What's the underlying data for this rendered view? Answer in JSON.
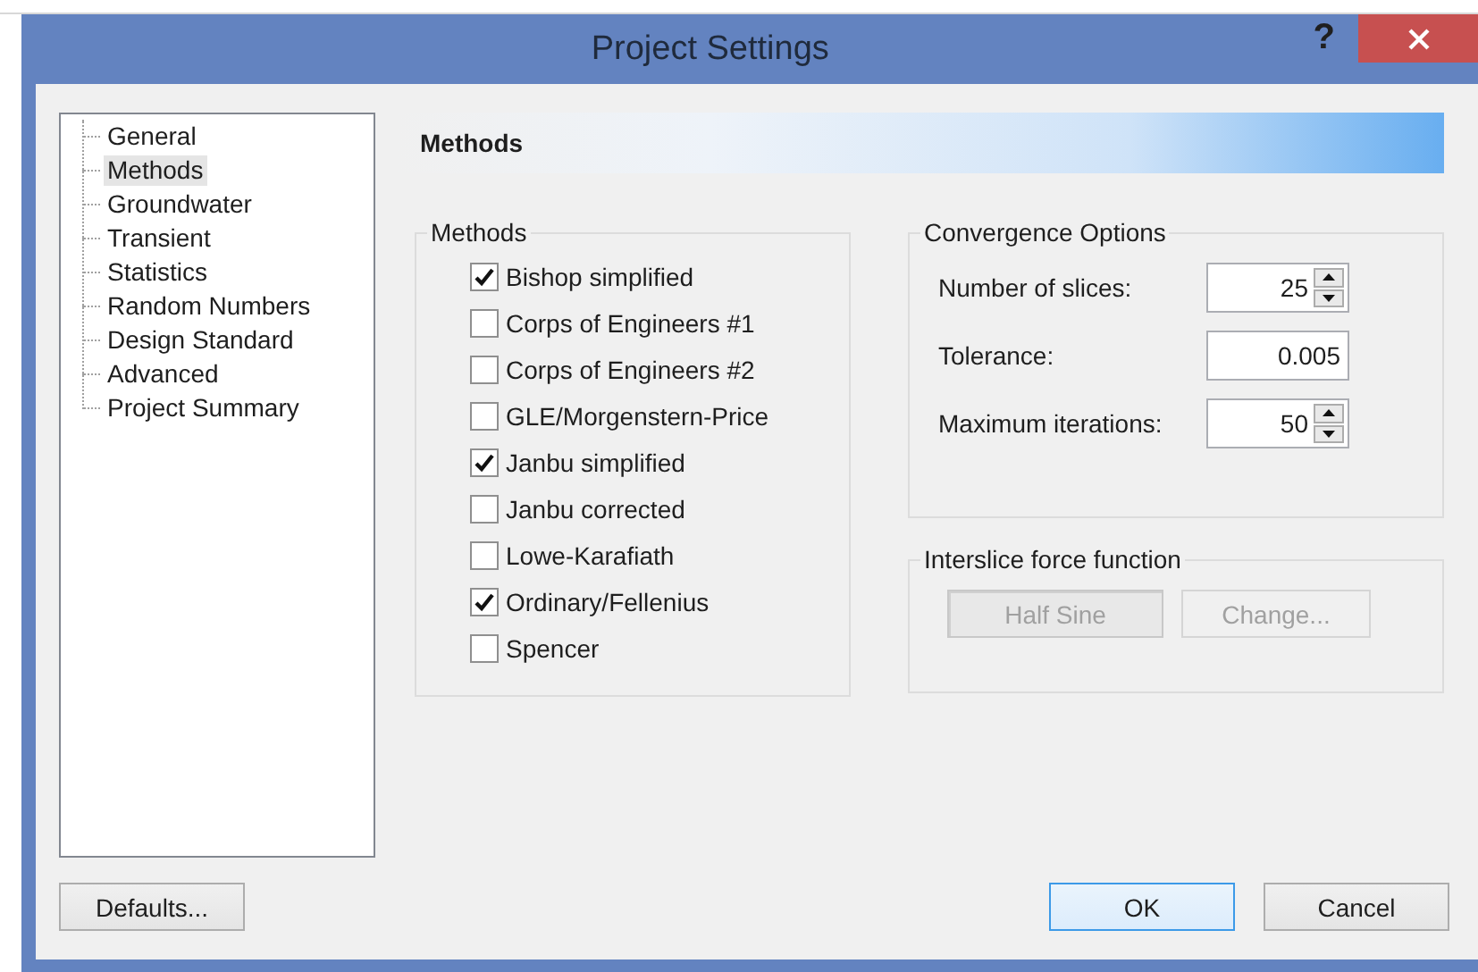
{
  "window": {
    "title": "Project Settings",
    "help": "?"
  },
  "sidebar": {
    "items": [
      {
        "label": "General",
        "selected": false
      },
      {
        "label": "Methods",
        "selected": true
      },
      {
        "label": "Groundwater",
        "selected": false
      },
      {
        "label": "Transient",
        "selected": false
      },
      {
        "label": "Statistics",
        "selected": false
      },
      {
        "label": "Random Numbers",
        "selected": false
      },
      {
        "label": "Design Standard",
        "selected": false
      },
      {
        "label": "Advanced",
        "selected": false
      },
      {
        "label": "Project Summary",
        "selected": false
      }
    ]
  },
  "header": "Methods",
  "methods": {
    "title": "Methods",
    "items": [
      {
        "label": "Bishop simplified",
        "checked": true
      },
      {
        "label": "Corps of Engineers #1",
        "checked": false
      },
      {
        "label": "Corps of Engineers #2",
        "checked": false
      },
      {
        "label": "GLE/Morgenstern-Price",
        "checked": false
      },
      {
        "label": "Janbu simplified",
        "checked": true
      },
      {
        "label": "Janbu corrected",
        "checked": false
      },
      {
        "label": "Lowe-Karafiath",
        "checked": false
      },
      {
        "label": "Ordinary/Fellenius",
        "checked": true
      },
      {
        "label": "Spencer",
        "checked": false
      }
    ]
  },
  "convergence": {
    "title": "Convergence Options",
    "fields": [
      {
        "label": "Number of slices:",
        "value": "25",
        "kind": "spin"
      },
      {
        "label": "Tolerance:",
        "value": "0.005",
        "kind": "text"
      },
      {
        "label": "Maximum iterations:",
        "value": "50",
        "kind": "spin"
      }
    ]
  },
  "interslice": {
    "title": "Interslice force function",
    "buttons": [
      {
        "label": "Half Sine",
        "kind": "display",
        "disabled": true
      },
      {
        "label": "Change...",
        "kind": "button",
        "disabled": true
      }
    ]
  },
  "footer": {
    "buttons": [
      {
        "label": "Defaults...",
        "default": false
      },
      {
        "label": "OK",
        "default": true
      },
      {
        "label": "Cancel",
        "default": false
      }
    ]
  }
}
